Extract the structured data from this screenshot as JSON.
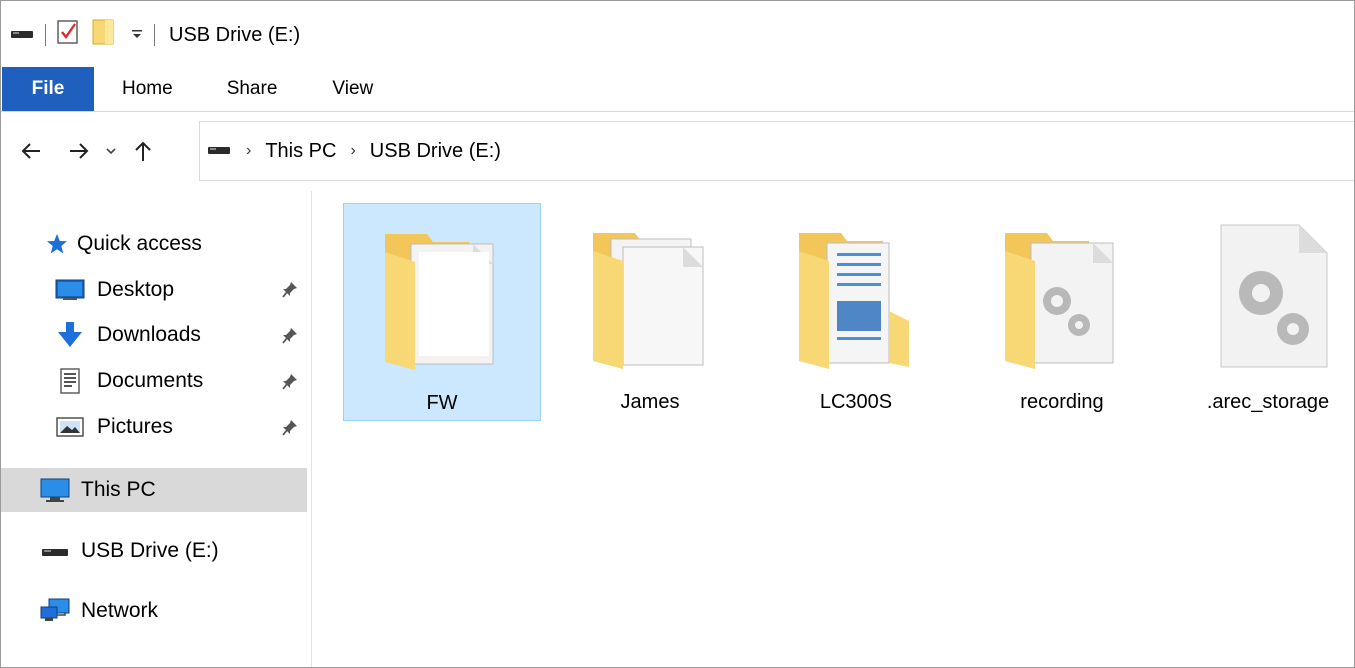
{
  "title": "USB Drive (E:)",
  "ribbon": {
    "tabs": [
      "File",
      "Home",
      "Share",
      "View"
    ]
  },
  "breadcrumb": [
    "This PC",
    "USB Drive (E:)"
  ],
  "sidebar": {
    "quick_access": "Quick access",
    "pinned": [
      "Desktop",
      "Downloads",
      "Documents",
      "Pictures"
    ],
    "this_pc": "This PC",
    "usb": "USB Drive (E:)",
    "network": "Network"
  },
  "files": [
    {
      "name": "FW",
      "type": "folder-doc",
      "selected": true
    },
    {
      "name": "James",
      "type": "folder-doc"
    },
    {
      "name": "LC300S",
      "type": "folder-doc-lines"
    },
    {
      "name": "recording",
      "type": "folder-gear"
    },
    {
      "name": ".arec_storage",
      "type": "file-gear"
    }
  ],
  "colors": {
    "file_tab": "#1f5fbd",
    "selection": "#cce8ff",
    "selection_border": "#99d1ff",
    "this_pc_highlight": "#d9d9d9",
    "folder_yellow": "#f8d775"
  }
}
